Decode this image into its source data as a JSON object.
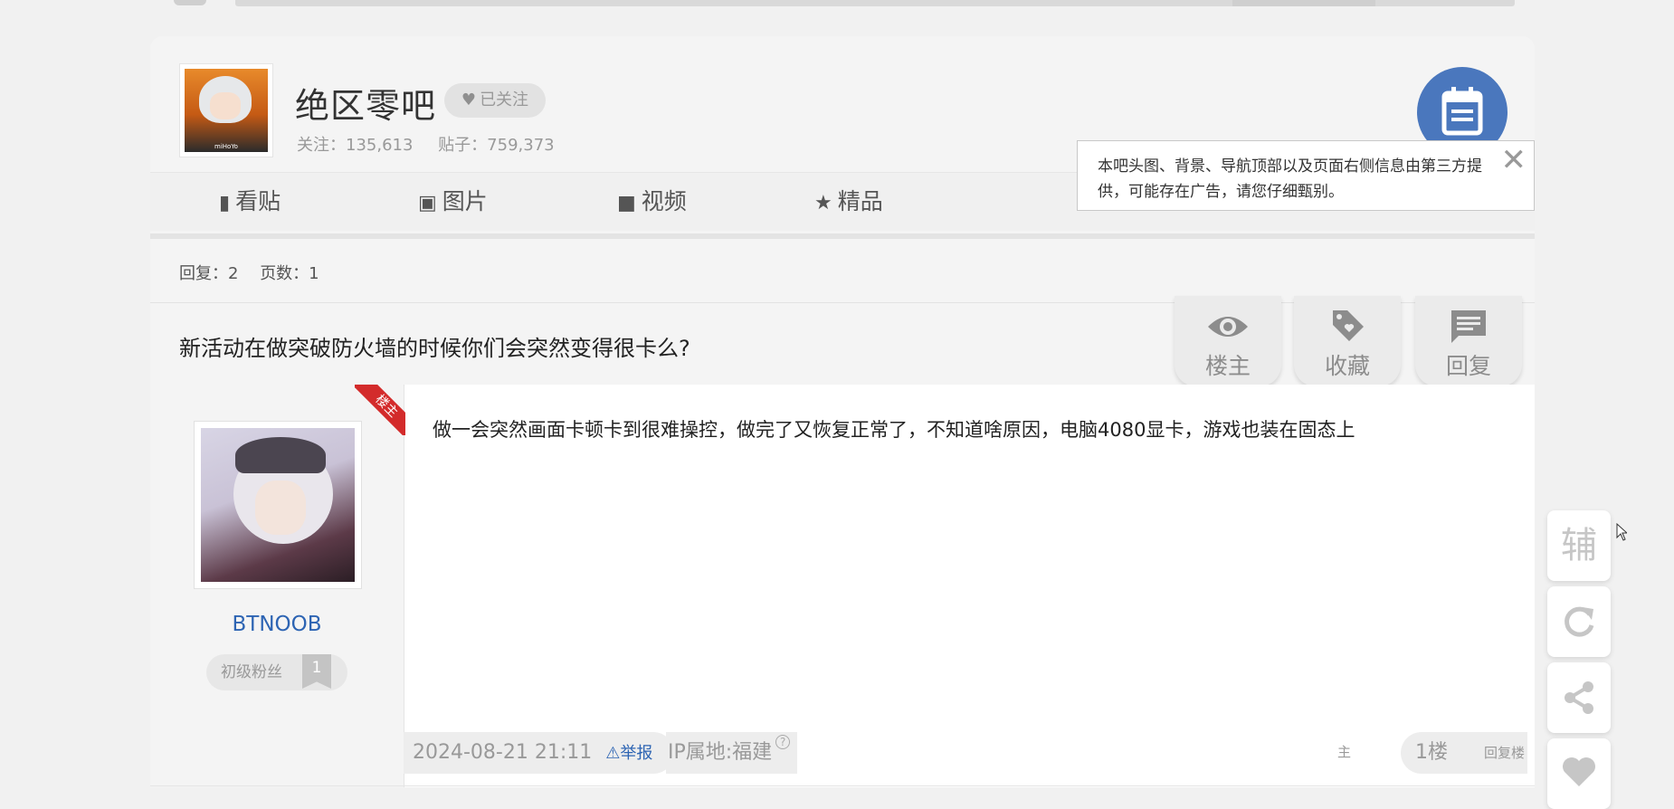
{
  "forum": {
    "name": "绝区零吧",
    "follow_label": "已关注",
    "follow_count_label": "关注：135,613",
    "post_count_label": "贴子：759,373",
    "avatar_text": "miHoYo"
  },
  "nav": {
    "items": [
      {
        "label": "看贴",
        "icon": "document-icon"
      },
      {
        "label": "图片",
        "icon": "image-icon"
      },
      {
        "label": "视频",
        "icon": "video-icon"
      },
      {
        "label": "精品",
        "icon": "star-icon"
      }
    ]
  },
  "notice": {
    "text": "本吧头图、背景、导航顶部以及页面右侧信息由第三方提供，可能存在广告，请您仔细甄别。",
    "close": "✕"
  },
  "thread": {
    "reply_count_label": "回复：2",
    "page_count_label": "页数：1",
    "title": "新活动在做突破防火墙的时候你们会突然变得很卡么?",
    "actions": {
      "owner_only": "楼主",
      "collect": "收藏",
      "reply": "回复"
    }
  },
  "post": {
    "op_badge": "楼主",
    "author": "BTNOOB",
    "fan_level_label": "初级粉丝",
    "fan_level": "1",
    "content": "做一会突然画面卡顿卡到很难操控，做完了又恢复正常了，不知道啥原因，电脑4080显卡，游戏也装在固态上",
    "datetime": "2024-08-21 21:11",
    "report_label": "⚠举报",
    "ip_label": "IP属地:福建",
    "ip_help": "?",
    "floor": "1楼",
    "reply_floor_label": "回复楼",
    "reply_floor_suffix": "主"
  },
  "side": {
    "assist_label": "辅"
  },
  "colors": {
    "accent_blue": "#4a77bd",
    "link_blue": "#2d64b3",
    "op_red": "#d32b2b"
  }
}
